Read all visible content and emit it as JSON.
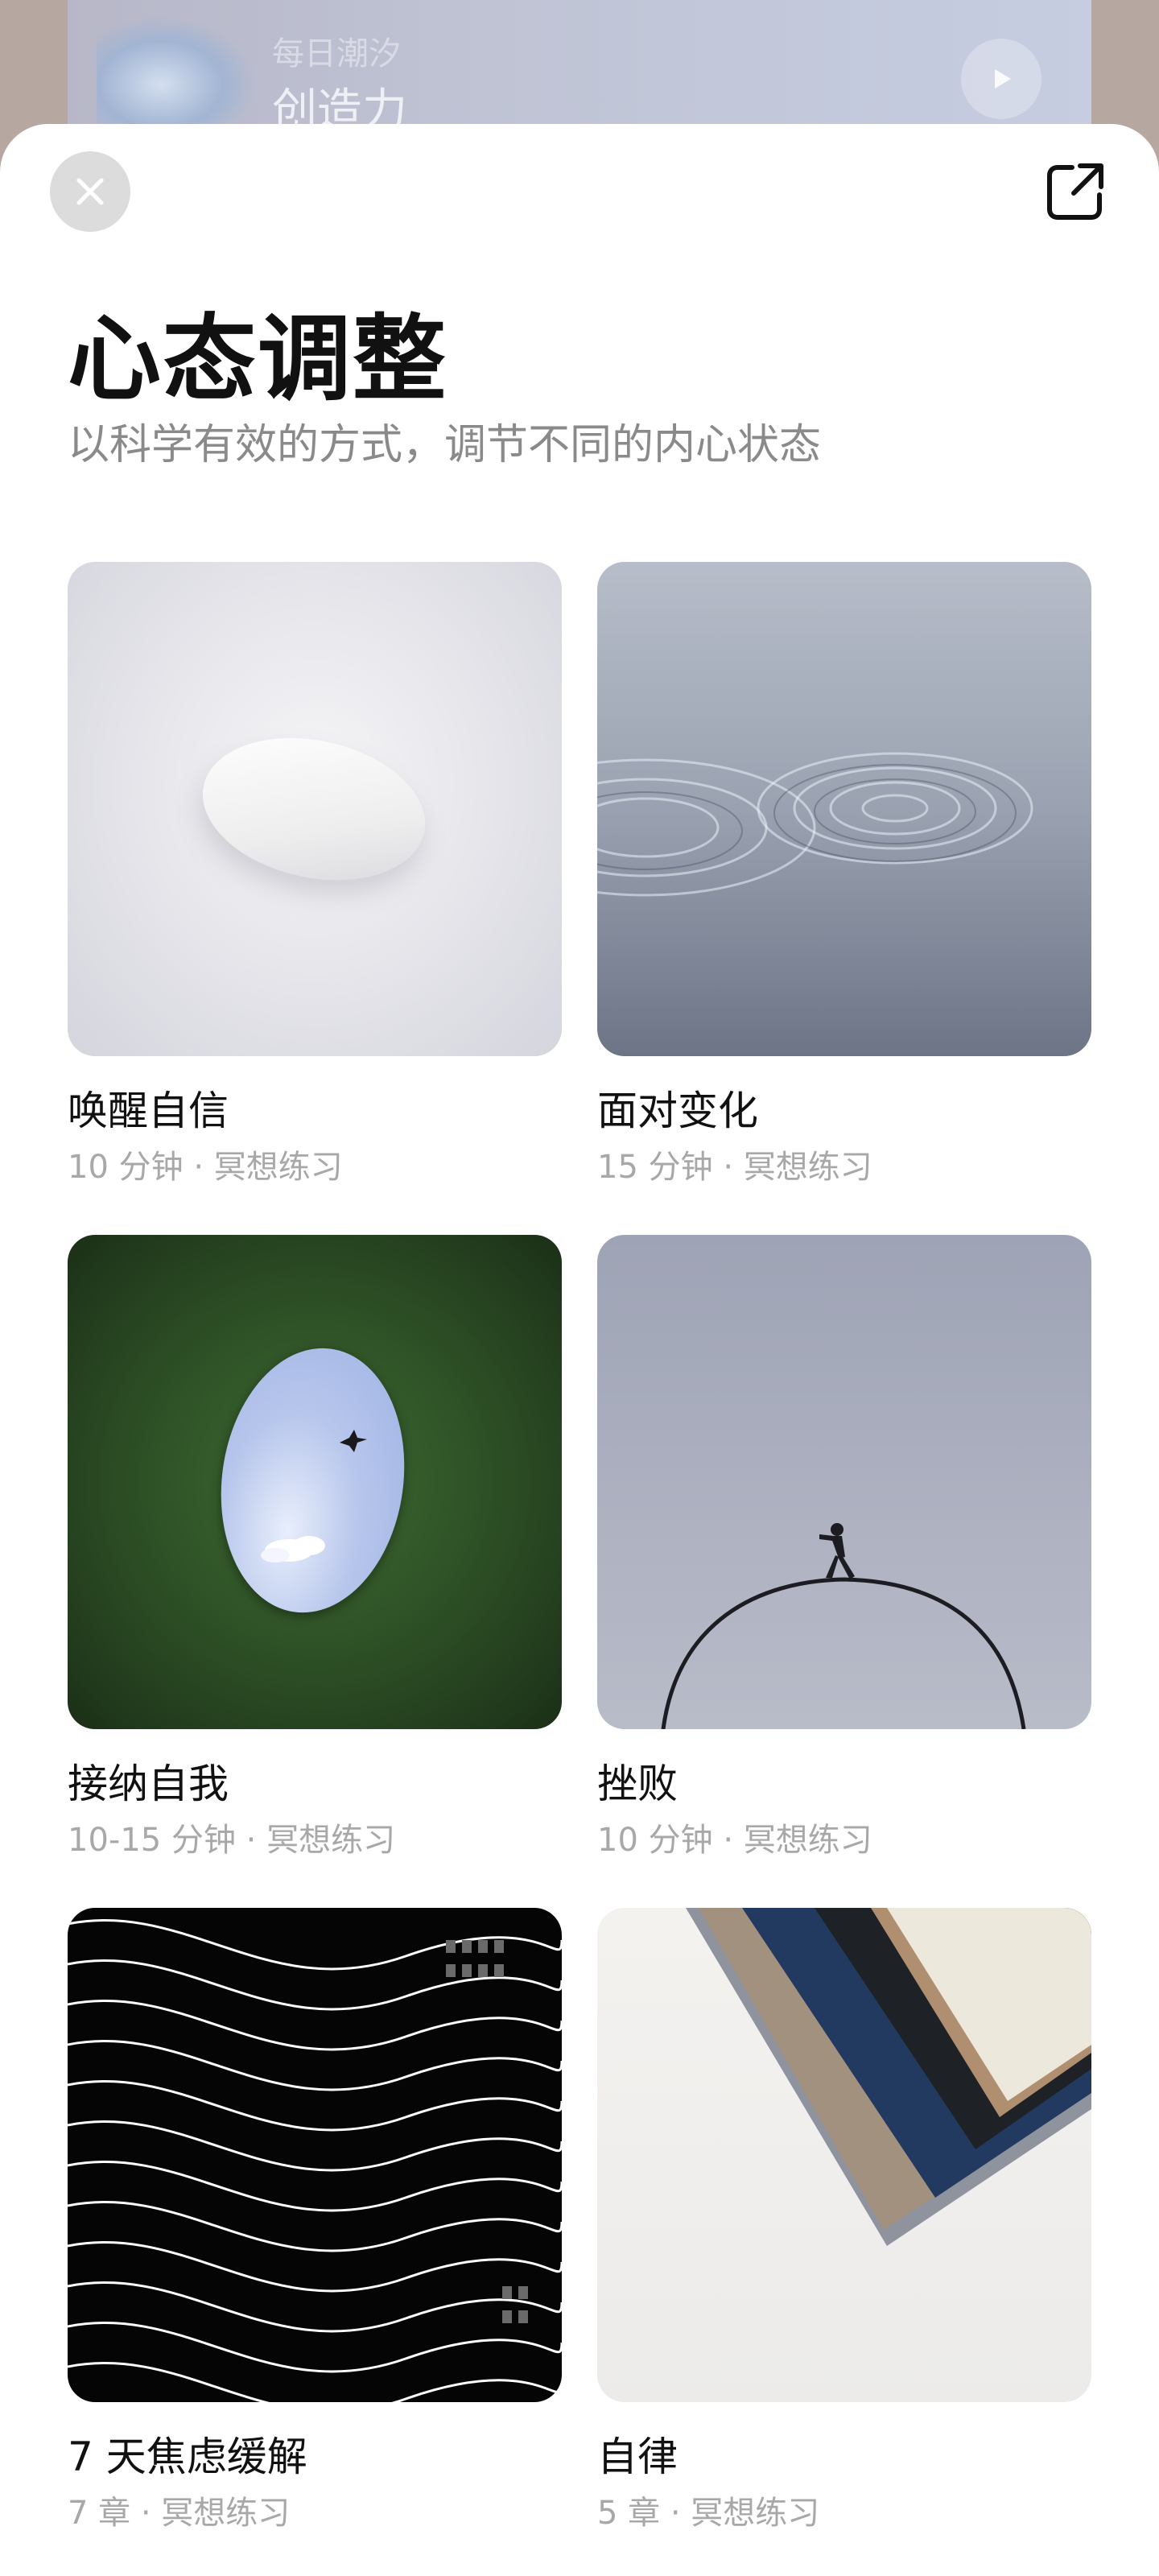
{
  "background_card": {
    "subtitle": "每日潮汐",
    "title": "创造力"
  },
  "header": {
    "title": "心态调整",
    "subtitle": "以科学有效的方式，调节不同的内心状态"
  },
  "items": [
    {
      "title": "唤醒自信",
      "meta": "10 分钟 · 冥想练习"
    },
    {
      "title": "面对变化",
      "meta": "15 分钟 · 冥想练习"
    },
    {
      "title": "接纳自我",
      "meta": "10-15 分钟 · 冥想练习"
    },
    {
      "title": "挫败",
      "meta": "10 分钟 · 冥想练习"
    },
    {
      "title": "7 天焦虑缓解",
      "meta": "7 章 · 冥想练习"
    },
    {
      "title": "自律",
      "meta": "5 章 · 冥想练习"
    }
  ],
  "icons": {
    "close": "close-icon",
    "share": "share-icon",
    "play": "play-icon"
  }
}
